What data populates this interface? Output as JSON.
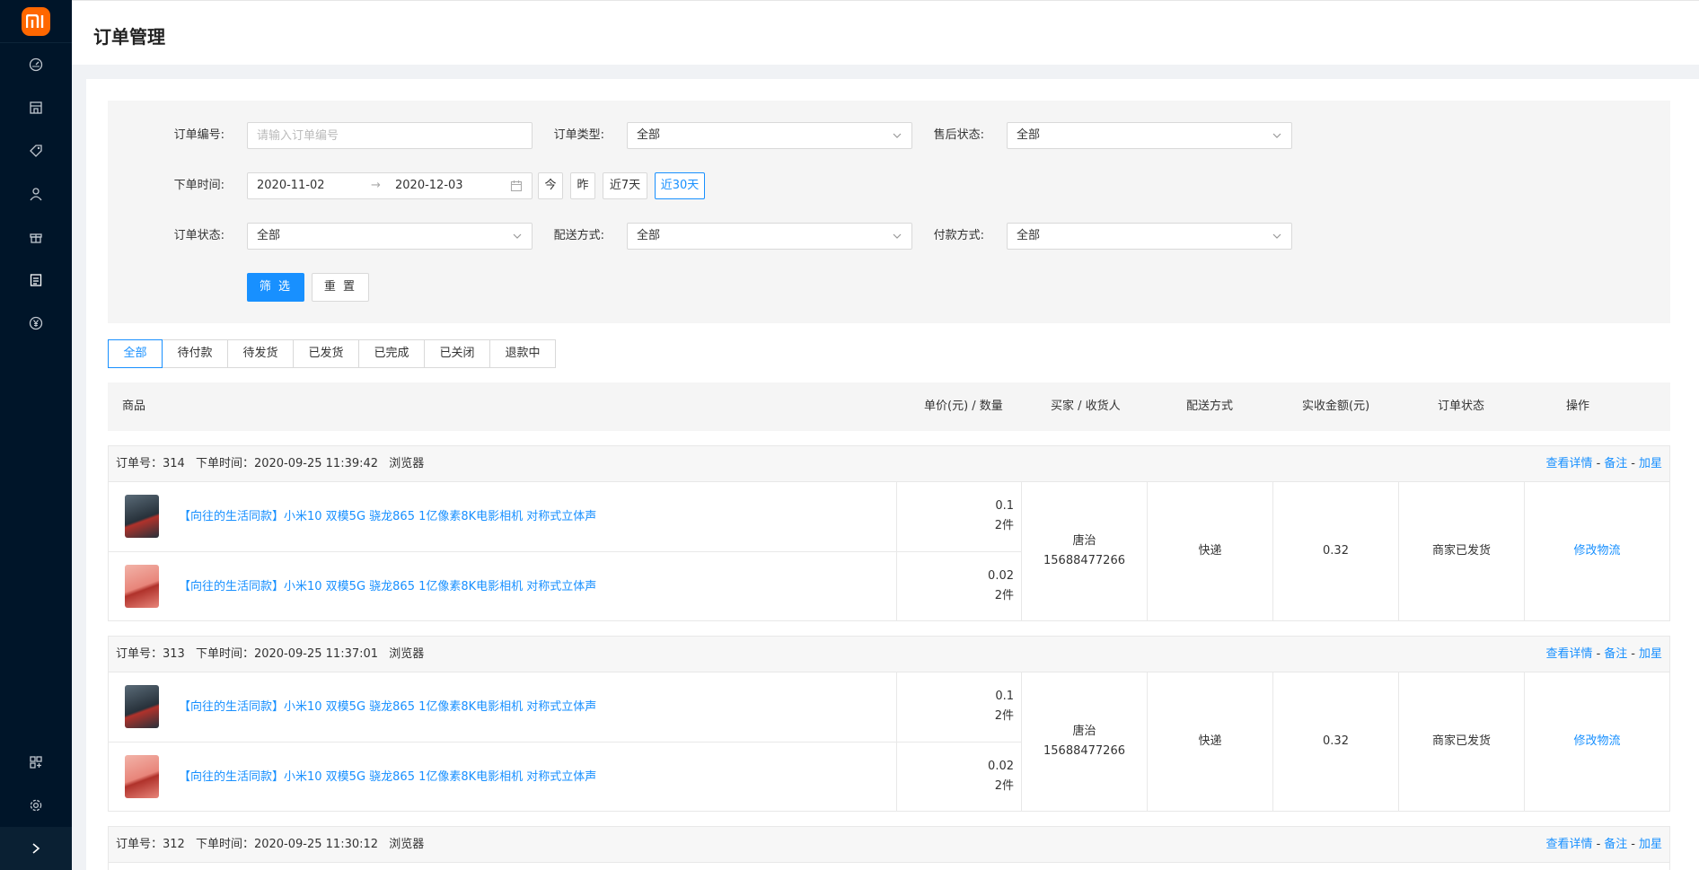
{
  "app": {
    "logo_text": "mi"
  },
  "header": {
    "title": "订单管理"
  },
  "sidebar": {
    "items": [
      {
        "icon": "dashboard-icon"
      },
      {
        "icon": "store-icon"
      },
      {
        "icon": "tag-icon"
      },
      {
        "icon": "user-icon"
      },
      {
        "icon": "gift-icon"
      },
      {
        "icon": "order-list-icon",
        "active": true
      },
      {
        "icon": "yen-icon"
      }
    ],
    "bottom_items": [
      {
        "icon": "apps-icon"
      },
      {
        "icon": "gear-icon"
      }
    ],
    "expand_icon": "chevron-right-icon"
  },
  "filter": {
    "order_no_label": "订单编号:",
    "order_no_placeholder": "请输入订单编号",
    "order_type_label": "订单类型:",
    "order_type_value": "全部",
    "aftersale_label": "售后状态:",
    "aftersale_value": "全部",
    "order_time_label": "下单时间:",
    "date_start": "2020-11-02",
    "date_arrow": "→",
    "date_end": "2020-12-03",
    "quick_today": "今",
    "quick_yesterday": "昨",
    "quick_7": "近7天",
    "quick_30": "近30天",
    "order_status_label": "订单状态:",
    "order_status_value": "全部",
    "delivery_label": "配送方式:",
    "delivery_value": "全部",
    "payment_label": "付款方式:",
    "payment_value": "全部",
    "filter_button": "筛 选",
    "reset_button": "重 置"
  },
  "tabs": [
    "全部",
    "待付款",
    "待发货",
    "已发货",
    "已完成",
    "已关闭",
    "退款中"
  ],
  "table": {
    "headers": {
      "product": "商品",
      "price_qty": "单价(元) / 数量",
      "buyer": "买家 / 收货人",
      "delivery": "配送方式",
      "amount": "实收金额(元)",
      "status": "订单状态",
      "actions": "操作"
    }
  },
  "orders": [
    {
      "order_no": "订单号：314",
      "order_time": "下单时间：2020-09-25 11:39:42",
      "source": "浏览器",
      "action_detail": "查看详情",
      "action_note": "备注",
      "action_star": "加星",
      "sep": "-",
      "products": [
        {
          "name": "【向往的生活同款】小米10 双模5G 骁龙865 1亿像素8K电影相机 对称式立体声",
          "price": "0.1",
          "qty": "2件",
          "color": "#3a4652"
        },
        {
          "name": "【向往的生活同款】小米10 双模5G 骁龙865 1亿像素8K电影相机 对称式立体声",
          "price": "0.02",
          "qty": "2件",
          "color": "#e8857a"
        }
      ],
      "buyer_name": "唐治",
      "buyer_phone": "15688477266",
      "delivery": "快递",
      "amount": "0.32",
      "status": "商家已发货",
      "op": "修改物流"
    },
    {
      "order_no": "订单号：313",
      "order_time": "下单时间：2020-09-25 11:37:01",
      "source": "浏览器",
      "action_detail": "查看详情",
      "action_note": "备注",
      "action_star": "加星",
      "sep": "-",
      "products": [
        {
          "name": "【向往的生活同款】小米10 双模5G 骁龙865 1亿像素8K电影相机 对称式立体声",
          "price": "0.1",
          "qty": "2件",
          "color": "#3a4652"
        },
        {
          "name": "【向往的生活同款】小米10 双模5G 骁龙865 1亿像素8K电影相机 对称式立体声",
          "price": "0.02",
          "qty": "2件",
          "color": "#e8857a"
        }
      ],
      "buyer_name": "唐治",
      "buyer_phone": "15688477266",
      "delivery": "快递",
      "amount": "0.32",
      "status": "商家已发货",
      "op": "修改物流"
    },
    {
      "order_no": "订单号：312",
      "order_time": "下单时间：2020-09-25 11:30:12",
      "source": "浏览器",
      "action_detail": "查看详情",
      "action_note": "备注",
      "action_star": "加星",
      "sep": "-"
    }
  ]
}
